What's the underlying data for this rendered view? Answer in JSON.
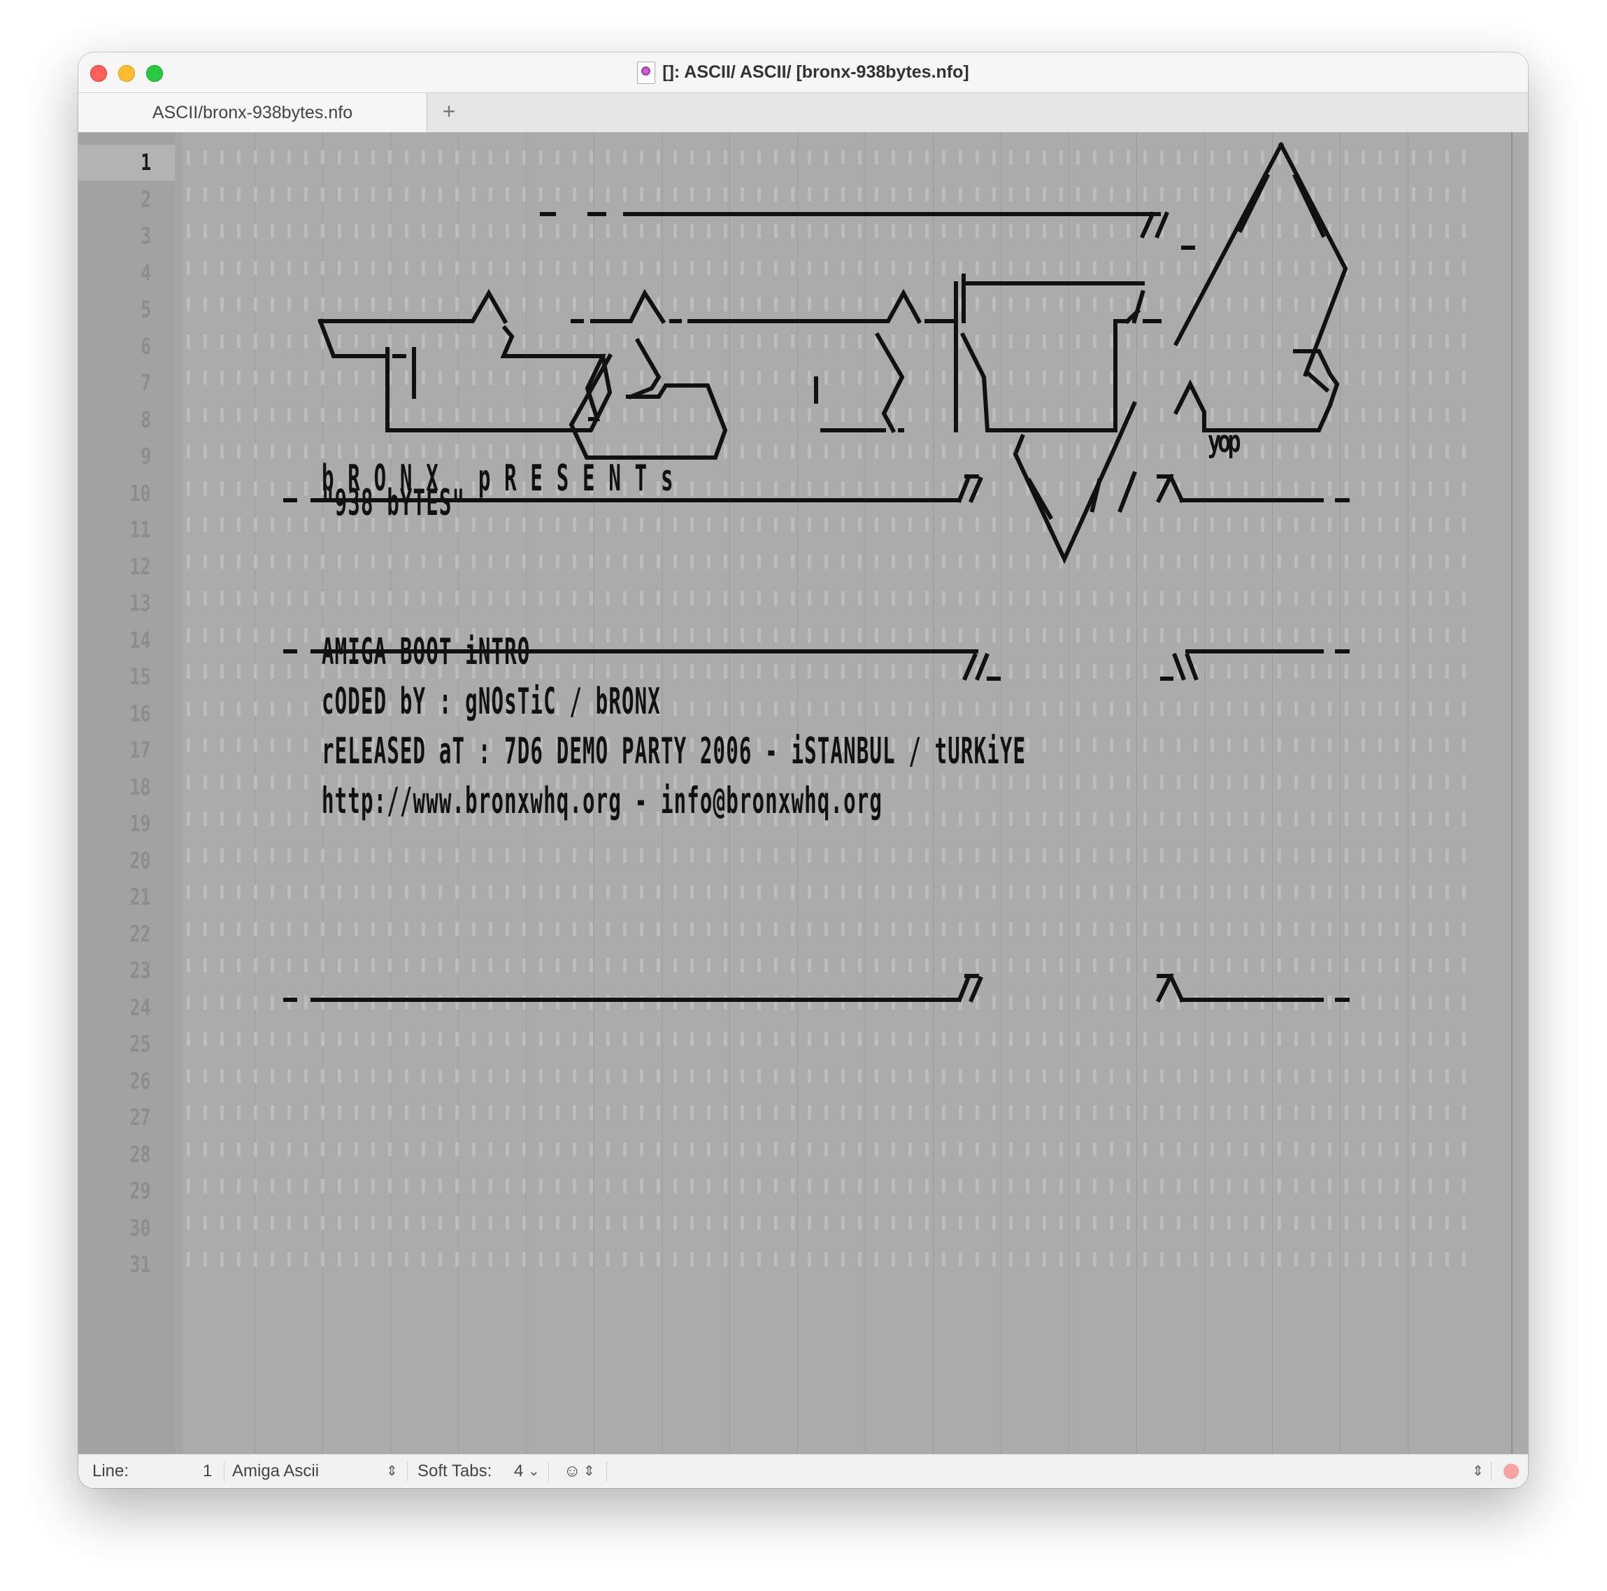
{
  "window": {
    "title": "[]: ASCII/ ASCII/ [bronx-938bytes.nfo]",
    "tab_label": "ASCII/bronx-938bytes.nfo",
    "add_tab_symbol": "+"
  },
  "editor": {
    "line_numbers": [
      "1",
      "2",
      "3",
      "4",
      "5",
      "6",
      "7",
      "8",
      "9",
      "10",
      "11",
      "12",
      "13",
      "14",
      "15",
      "16",
      "17",
      "18",
      "19",
      "20",
      "21",
      "22",
      "23",
      "24",
      "25",
      "26",
      "27",
      "28",
      "29",
      "30",
      "31"
    ],
    "current_line": "1",
    "art_signature": "yop",
    "text_lines": {
      "l14": "b R O N X   p R E S E N T s",
      "l15": "\"938 bYTES\"",
      "l21": "AMIGA BOOT iNTRO",
      "l23": "cODED bY : gNOsTiC / bRONX",
      "l25": "rELEASED aT : 7D6 DEMO PARTY 2006 - iSTANBUL / tURKiYE",
      "l27": "http://www.bronxwhq.org - info@bronxwhq.org"
    }
  },
  "status": {
    "line_label": "Line:",
    "line_value": "1",
    "encoding": "Amiga Ascii",
    "tabs_label": "Soft Tabs:",
    "tabs_value": "4",
    "updown_symbol": "⌃⌄"
  },
  "colors": {
    "editor_bg": "#ababab",
    "gutter_bg": "#a2a2a2",
    "text": "#111111",
    "close": "#fe5f57",
    "minimize": "#febc2e",
    "maximize": "#28c840"
  }
}
